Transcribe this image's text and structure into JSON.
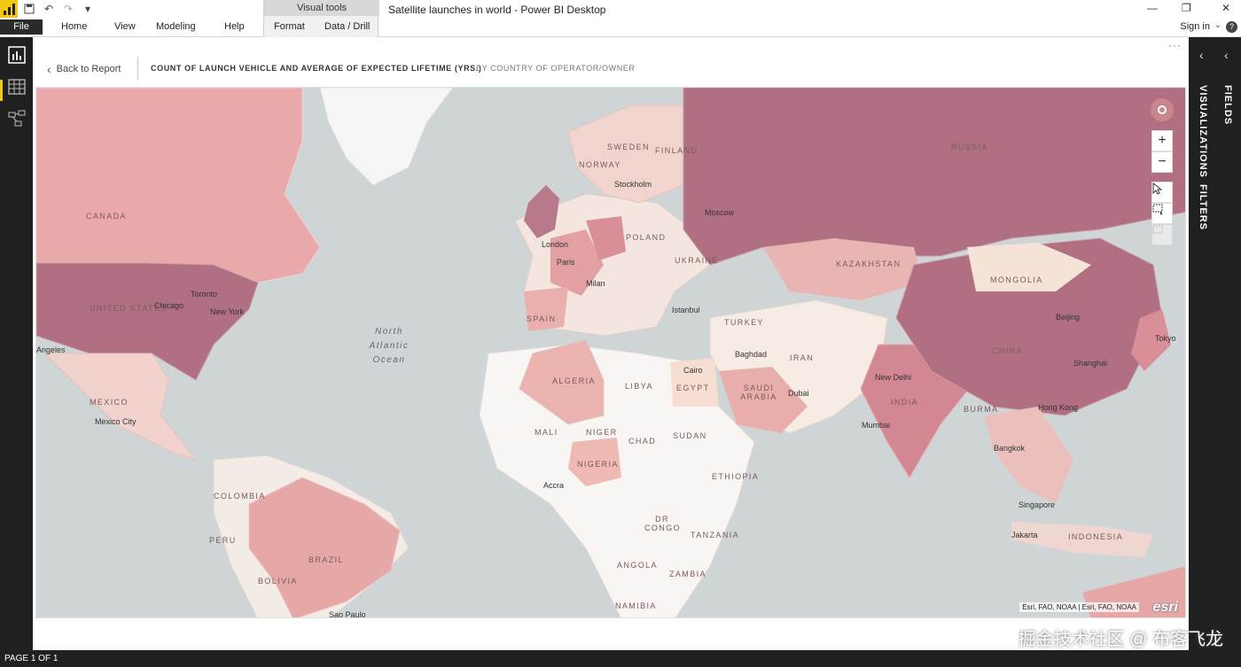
{
  "window": {
    "title": "Satellite launches in world - Power BI Desktop",
    "minimize": "—",
    "restore": "❐",
    "close": "✕"
  },
  "ribbon": {
    "file": "File",
    "tabs": [
      "Home",
      "View",
      "Modeling",
      "Help"
    ],
    "context_group": "Visual tools",
    "context_tabs": [
      "Format",
      "Data / Drill"
    ],
    "signin": "Sign in"
  },
  "panes": {
    "visualizations": "VISUALIZATIONS",
    "fields": "FIELDS",
    "filters": "FILTERS"
  },
  "visual": {
    "back": "Back to Report",
    "title": "COUNT OF LAUNCH VEHICLE AND AVERAGE OF EXPECTED LIFETIME (YRS.)",
    "subtitle": "BY COUNTRY OF OPERATOR/OWNER",
    "more": "···"
  },
  "map": {
    "ocean_label": "North Atlantic Ocean",
    "countries": [
      "CANADA",
      "UNITED STATES",
      "MEXICO",
      "COLOMBIA",
      "PERU",
      "BOLIVIA",
      "BRAZIL",
      "SPAIN",
      "ALGERIA",
      "LIBYA",
      "EGYPT",
      "MALI",
      "NIGER",
      "CHAD",
      "SUDAN",
      "NIGERIA",
      "ETHIOPIA",
      "DR CONGO",
      "TANZANIA",
      "ANGOLA",
      "ZAMBIA",
      "NAMIBIA",
      "SAUDI ARABIA",
      "IRAN",
      "TURKEY",
      "UKRAINE",
      "POLAND",
      "SWEDEN",
      "NORWAY",
      "FINLAND",
      "RUSSIA",
      "KAZAKHSTAN",
      "MONGOLIA",
      "CHINA",
      "INDIA",
      "BURMA",
      "INDONESIA"
    ],
    "cities": [
      "Toronto",
      "Chicago",
      "New York",
      "Angeles",
      "Mexico City",
      "Accra",
      "Sao Paulo",
      "London",
      "Paris",
      "Milan",
      "Istanbul",
      "Cairo",
      "Baghdad",
      "Dubai",
      "Moscow",
      "Stockholm",
      "New Delhi",
      "Mumbai",
      "Beijing",
      "Shanghai",
      "Hong Kong",
      "Bangkok",
      "Singapore",
      "Jakarta",
      "Tokyo"
    ],
    "attribution": "Esri, FAO, NOAA | Esri, FAO, NOAA",
    "esri": "esri",
    "zoom_in": "+",
    "zoom_out": "−"
  },
  "status": {
    "page": "PAGE 1 OF 1"
  },
  "watermark": "掘金技术社区 @ 布客飞龙"
}
